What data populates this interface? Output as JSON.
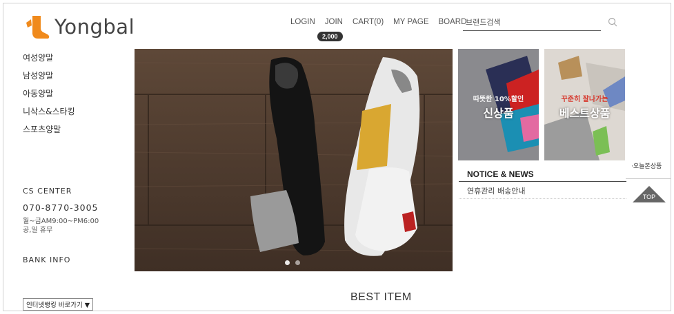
{
  "header": {
    "brand": "Yongbal",
    "nav": [
      "LOGIN",
      "JOIN",
      "CART(0)",
      "MY PAGE",
      "BOARD"
    ],
    "points_badge": "2,000",
    "search_placeholder": "브랜드검색"
  },
  "sidebar": {
    "items": [
      "여성양말",
      "남성양말",
      "아동양말",
      "니삭스&스타킹",
      "스포츠양말"
    ],
    "cs_title": "CS CENTER",
    "cs_phone": "070-8770-3005",
    "cs_hours_1": "월~금AM9:00~PM6:00",
    "cs_hours_2": "공,일 휴무",
    "bank_title": "BANK INFO",
    "bank_select": "인터넷뱅킹 바로가기"
  },
  "promos": [
    {
      "line1": "따뜻한 10%할인",
      "line2": "신상품"
    },
    {
      "line1": "꾸준히 잘나가는",
      "line2": "베스트상품"
    }
  ],
  "notice": {
    "title": "NOTICE & NEWS",
    "item": "연휴관리 배송안내"
  },
  "right": {
    "today": "·오늘본상품",
    "top": "TOP"
  },
  "main": {
    "best_title": "BEST ITEM"
  },
  "colors": {
    "accent": "#f08a1c",
    "dark": "#333333"
  }
}
